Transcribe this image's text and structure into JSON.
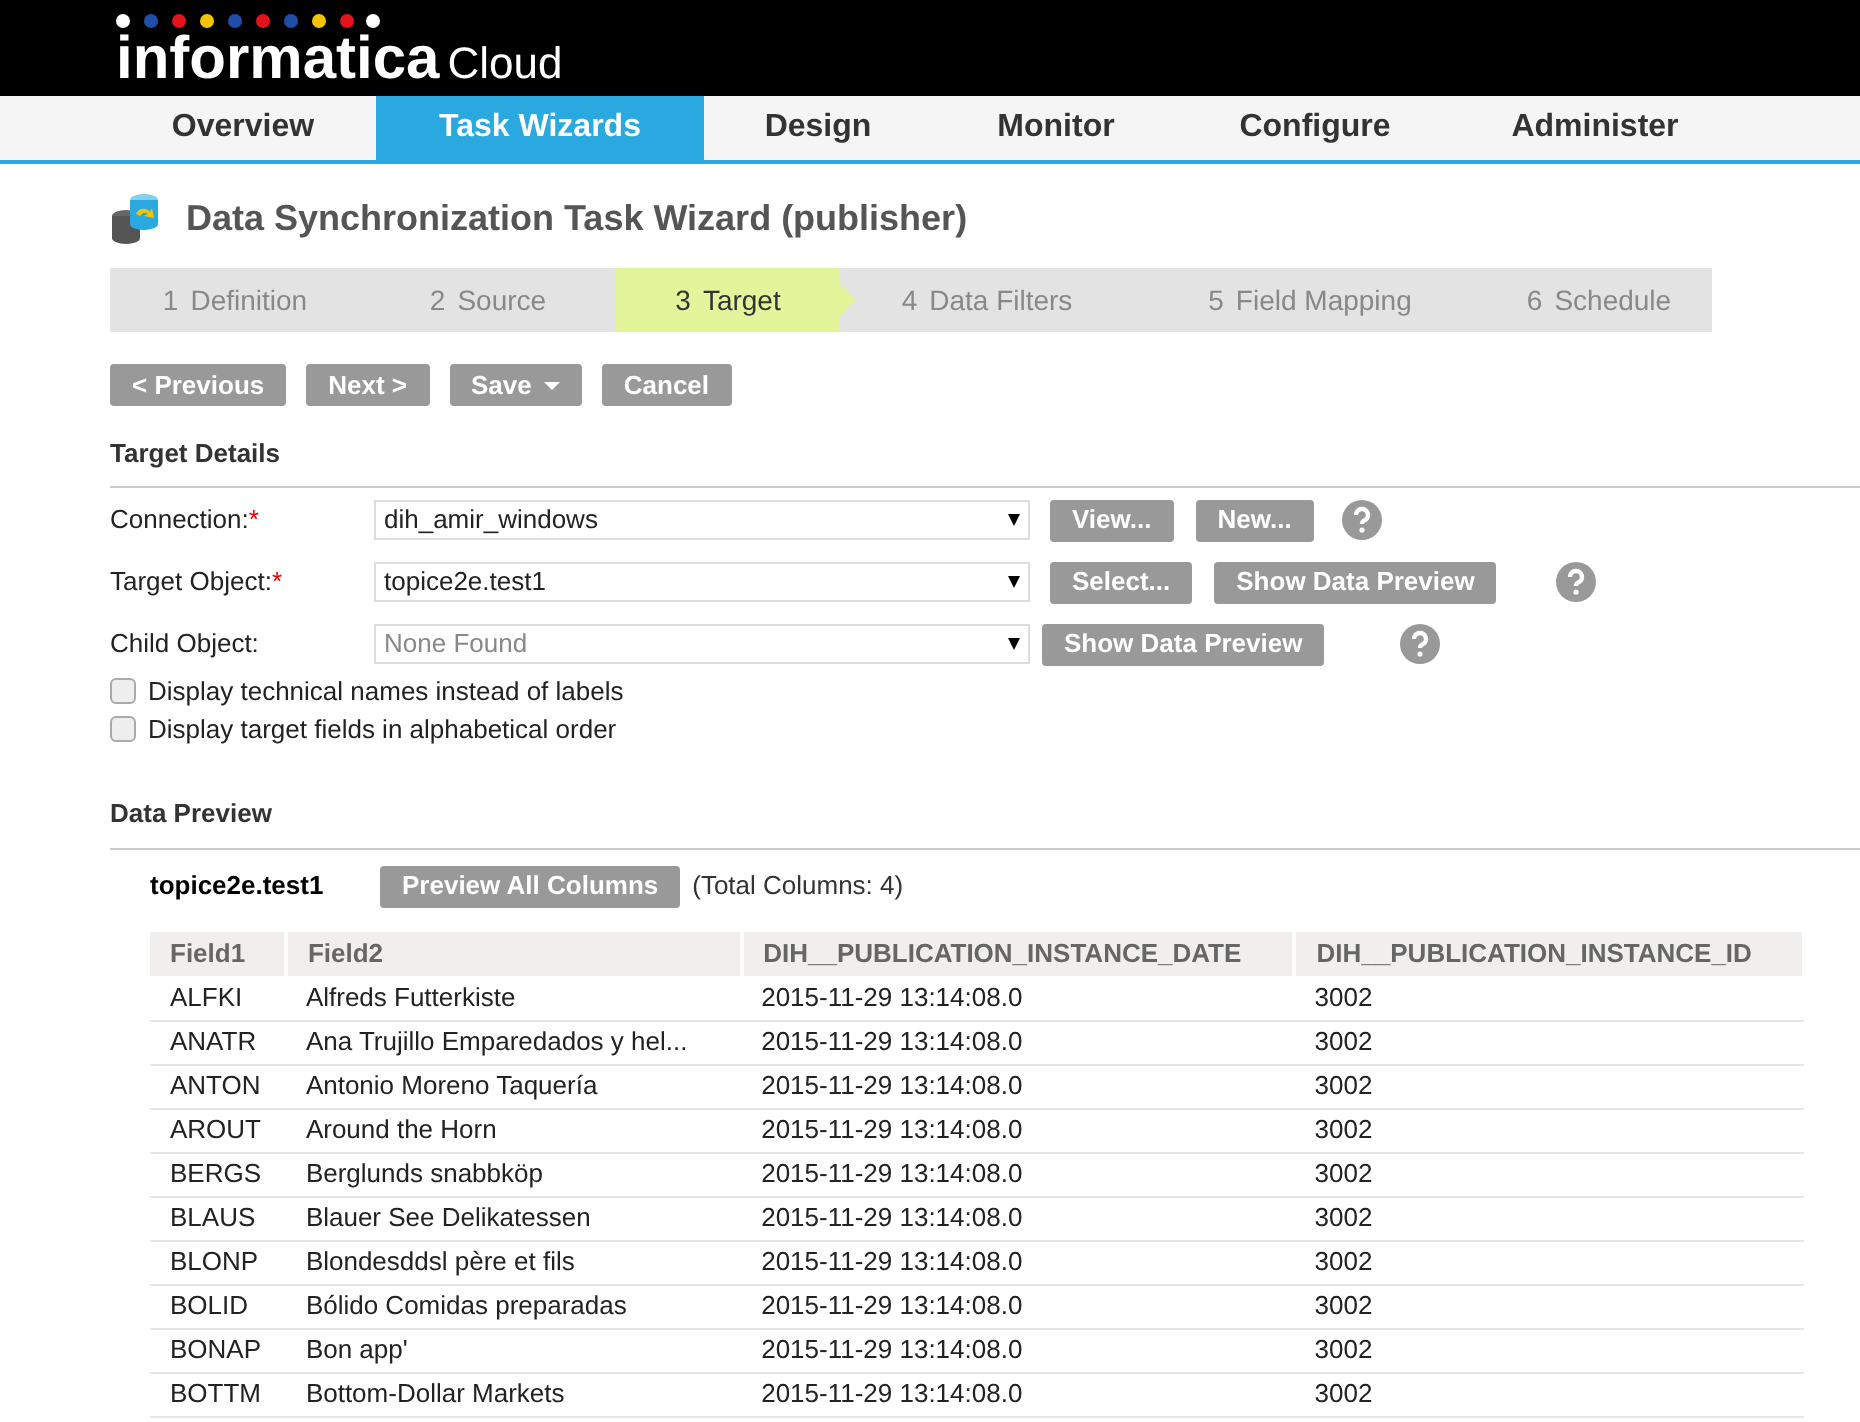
{
  "logo": {
    "brand": "informatica",
    "product": "Cloud"
  },
  "nav": [
    {
      "label": "Overview",
      "selected": false
    },
    {
      "label": "Task Wizards",
      "selected": true
    },
    {
      "label": "Design",
      "selected": false
    },
    {
      "label": "Monitor",
      "selected": false
    },
    {
      "label": "Configure",
      "selected": false
    },
    {
      "label": "Administer",
      "selected": false
    }
  ],
  "page_title": "Data Synchronization Task Wizard (publisher)",
  "steps": [
    {
      "number": "1",
      "label": "Definition",
      "selected": false
    },
    {
      "number": "2",
      "label": "Source",
      "selected": false
    },
    {
      "number": "3",
      "label": "Target",
      "selected": true
    },
    {
      "number": "4",
      "label": "Data Filters",
      "selected": false
    },
    {
      "number": "5",
      "label": "Field Mapping",
      "selected": false
    },
    {
      "number": "6",
      "label": "Schedule",
      "selected": false
    }
  ],
  "toolbar": [
    {
      "label": "< Previous",
      "kind": "plain"
    },
    {
      "label": "Next >",
      "kind": "plain"
    },
    {
      "label": "Save",
      "kind": "dropdown"
    },
    {
      "label": "Cancel",
      "kind": "plain"
    }
  ],
  "target_details": {
    "heading": "Target Details",
    "fields": [
      {
        "label": "Connection:",
        "required_mark": "*",
        "value": "dih_amir_windows",
        "disabled": false,
        "buttons": [
          "View...",
          "New..."
        ]
      },
      {
        "label": "Target Object:",
        "required_mark": "*",
        "value": "topice2e.test1",
        "disabled": false,
        "buttons": [
          "Select...",
          "Show Data Preview"
        ]
      },
      {
        "label": "Child Object:",
        "value": "None Found",
        "disabled": true,
        "buttons": [
          "Show Data Preview"
        ]
      }
    ],
    "options": [
      {
        "label": "Display technical names instead of labels",
        "checked": false
      },
      {
        "label": "Display target fields in alphabetical order",
        "checked": false
      }
    ]
  },
  "data_preview": {
    "heading": "Data Preview",
    "object": "topice2e.test1",
    "button": "Preview All Columns",
    "total": "(Total Columns: 4)",
    "columns": [
      "Field1",
      "Field2",
      "DIH__PUBLICATION_INSTANCE_DATE",
      "DIH__PUBLICATION_INSTANCE_ID"
    ],
    "rows": [
      [
        "ALFKI",
        "Alfreds Futterkiste",
        "2015-11-29 13:14:08.0",
        "3002"
      ],
      [
        "ANATR",
        "Ana Trujillo Emparedados y hel...",
        "2015-11-29 13:14:08.0",
        "3002"
      ],
      [
        "ANTON",
        "Antonio Moreno Taquería",
        "2015-11-29 13:14:08.0",
        "3002"
      ],
      [
        "AROUT",
        "Around the Horn",
        "2015-11-29 13:14:08.0",
        "3002"
      ],
      [
        "BERGS",
        "Berglunds snabbköp",
        "2015-11-29 13:14:08.0",
        "3002"
      ],
      [
        "BLAUS",
        "Blauer See Delikatessen",
        "2015-11-29 13:14:08.0",
        "3002"
      ],
      [
        "BLONP",
        "Blondesddsl père et fils",
        "2015-11-29 13:14:08.0",
        "3002"
      ],
      [
        "BOLID",
        "Bólido Comidas preparadas",
        "2015-11-29 13:14:08.0",
        "3002"
      ],
      [
        "BONAP",
        "Bon app'",
        "2015-11-29 13:14:08.0",
        "3002"
      ],
      [
        "BOTTM",
        "Bottom-Dollar Markets",
        "2015-11-29 13:14:08.0",
        "3002"
      ]
    ]
  }
}
